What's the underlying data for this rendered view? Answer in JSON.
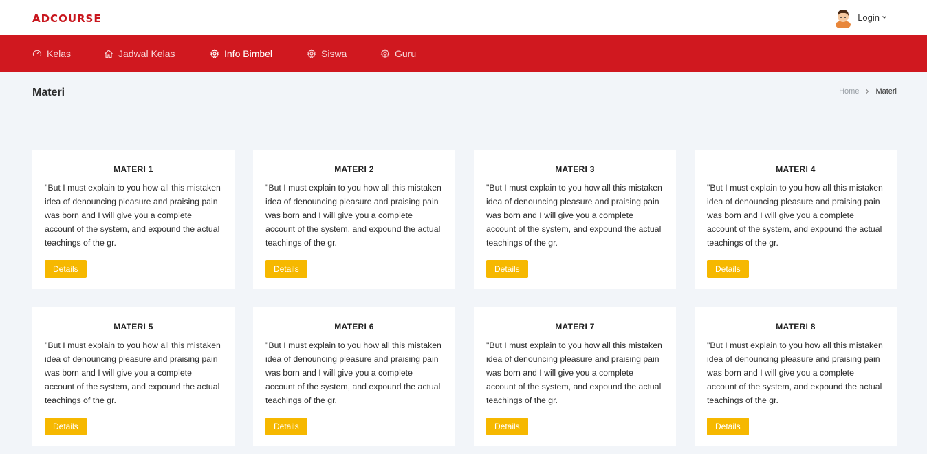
{
  "brand": "ADCOURSE",
  "user": {
    "login_label": "Login",
    "avatar_icon": "user-avatar"
  },
  "nav": {
    "items": [
      {
        "label": "Kelas",
        "icon": "dashboard-gauge-icon"
      },
      {
        "label": "Jadwal Kelas",
        "icon": "home-icon"
      },
      {
        "label": "Info Bimbel",
        "icon": "gear-icon",
        "active": true
      },
      {
        "label": "Siswa",
        "icon": "gear-icon"
      },
      {
        "label": "Guru",
        "icon": "gear-icon"
      }
    ]
  },
  "page": {
    "title": "Materi",
    "breadcrumb": {
      "home": "Home",
      "current": "Materi"
    }
  },
  "cards": [
    {
      "title": "MATERI 1",
      "text": "\"But I must explain to you how all this mistaken idea of denouncing pleasure and praising pain was born and I will give you a complete account of the system, and expound the actual teachings of the gr.",
      "button": "Details"
    },
    {
      "title": "MATERI 2",
      "text": "\"But I must explain to you how all this mistaken idea of denouncing pleasure and praising pain was born and I will give you a complete account of the system, and expound the actual teachings of the gr.",
      "button": "Details"
    },
    {
      "title": "MATERI 3",
      "text": "\"But I must explain to you how all this mistaken idea of denouncing pleasure and praising pain was born and I will give you a complete account of the system, and expound the actual teachings of the gr.",
      "button": "Details"
    },
    {
      "title": "MATERI 4",
      "text": "\"But I must explain to you how all this mistaken idea of denouncing pleasure and praising pain was born and I will give you a complete account of the system, and expound the actual teachings of the gr.",
      "button": "Details"
    },
    {
      "title": "MATERI 5",
      "text": "\"But I must explain to you how all this mistaken idea of denouncing pleasure and praising pain was born and I will give you a complete account of the system, and expound the actual teachings of the gr.",
      "button": "Details"
    },
    {
      "title": "MATERI 6",
      "text": "\"But I must explain to you how all this mistaken idea of denouncing pleasure and praising pain was born and I will give you a complete account of the system, and expound the actual teachings of the gr.",
      "button": "Details"
    },
    {
      "title": "MATERI 7",
      "text": "\"But I must explain to you how all this mistaken idea of denouncing pleasure and praising pain was born and I will give you a complete account of the system, and expound the actual teachings of the gr.",
      "button": "Details"
    },
    {
      "title": "MATERI 8",
      "text": "\"But I must explain to you how all this mistaken idea of denouncing pleasure and praising pain was born and I will give you a complete account of the system, and expound the actual teachings of the gr.",
      "button": "Details"
    }
  ],
  "colors": {
    "brand": "#c8161d",
    "navbar": "#d0181f",
    "button": "#f6b800",
    "background": "#f2f5f9"
  }
}
